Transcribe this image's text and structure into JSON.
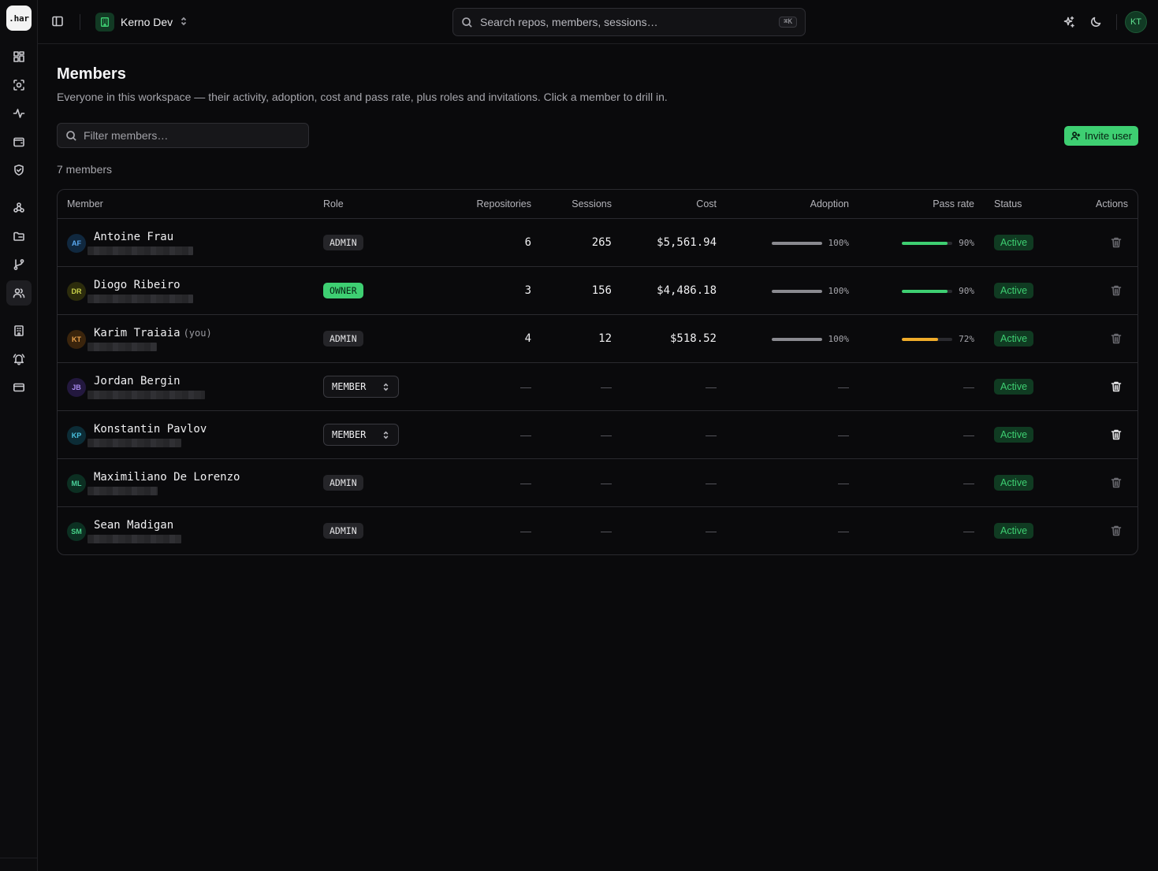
{
  "app": {
    "logo_text": ".har"
  },
  "sidebar": {
    "items": [
      {
        "name": "dashboard",
        "icon": "dashboard-icon",
        "active": false
      },
      {
        "name": "sessions",
        "icon": "scan-icon",
        "active": false
      },
      {
        "name": "activity",
        "icon": "activity-icon",
        "active": false
      },
      {
        "name": "wallet",
        "icon": "wallet-icon",
        "active": false
      },
      {
        "name": "security",
        "icon": "shield-icon",
        "active": false
      },
      {
        "name": "integrations",
        "icon": "network-icon",
        "active": false
      },
      {
        "name": "repositories",
        "icon": "folder-icon",
        "active": false
      },
      {
        "name": "branches",
        "icon": "git-branch-icon",
        "active": false
      },
      {
        "name": "members",
        "icon": "users-icon",
        "active": true
      },
      {
        "name": "organization",
        "icon": "building-icon",
        "active": false
      },
      {
        "name": "alerts",
        "icon": "bell-icon",
        "active": false
      },
      {
        "name": "billing",
        "icon": "credit-card-icon",
        "active": false
      }
    ]
  },
  "topbar": {
    "workspace": "Kerno Dev",
    "search_placeholder": "Search repos, members, sessions…",
    "search_shortcut": "⌘K",
    "user_initials": "KT"
  },
  "page": {
    "title": "Members",
    "subtitle": "Everyone in this workspace — their activity, adoption, cost and pass rate, plus roles and invitations. Click a member to drill in.",
    "filter_placeholder": "Filter members…",
    "invite_label": "Invite user",
    "member_count": "7 members"
  },
  "table": {
    "headers": {
      "member": "Member",
      "role": "Role",
      "repositories": "Repositories",
      "sessions": "Sessions",
      "cost": "Cost",
      "adoption": "Adoption",
      "pass_rate": "Pass rate",
      "status": "Status",
      "actions": "Actions"
    },
    "empty": "—",
    "rows": [
      {
        "initials": "AF",
        "name": "Antoine Frau",
        "you": "",
        "role": "ADMIN",
        "role_type": "badge",
        "repositories": "6",
        "sessions": "265",
        "cost": "$5,561.94",
        "adoption": 1.0,
        "adoption_label": "100%",
        "pass_rate": 0.9,
        "pass_label": "90%",
        "status": "Active",
        "avatar_bg": "#10283f",
        "avatar_fg": "#5aa9f0",
        "email_w": 134
      },
      {
        "initials": "DR",
        "name": "Diogo Ribeiro",
        "you": "",
        "role": "OWNER",
        "role_type": "owner",
        "repositories": "3",
        "sessions": "156",
        "cost": "$4,486.18",
        "adoption": 1.0,
        "adoption_label": "100%",
        "pass_rate": 0.9,
        "pass_label": "90%",
        "status": "Active",
        "avatar_bg": "#2c2c0c",
        "avatar_fg": "#c9d14a",
        "email_w": 134
      },
      {
        "initials": "KT",
        "name": "Karim Traiaia",
        "you": "(you)",
        "role": "ADMIN",
        "role_type": "badge",
        "repositories": "4",
        "sessions": "12",
        "cost": "$518.52",
        "adoption": 1.0,
        "adoption_label": "100%",
        "pass_rate": 0.72,
        "pass_label": "72%",
        "status": "Active",
        "avatar_bg": "#3a240c",
        "avatar_fg": "#e8a04a",
        "email_w": 88
      },
      {
        "initials": "JB",
        "name": "Jordan Bergin",
        "you": "",
        "role": "MEMBER",
        "role_type": "select",
        "status": "Active",
        "avatar_bg": "#23183e",
        "avatar_fg": "#a88af0",
        "email_w": 149
      },
      {
        "initials": "KP",
        "name": "Konstantin Pavlov",
        "you": "",
        "role": "MEMBER",
        "role_type": "select",
        "status": "Active",
        "avatar_bg": "#0c2c36",
        "avatar_fg": "#4ac2e0",
        "email_w": 119
      },
      {
        "initials": "ML",
        "name": "Maximiliano De Lorenzo",
        "you": "",
        "role": "ADMIN",
        "role_type": "badge",
        "status": "Active",
        "avatar_bg": "#0c2f22",
        "avatar_fg": "#4ad09a",
        "email_w": 89
      },
      {
        "initials": "SM",
        "name": "Sean Madigan",
        "you": "",
        "role": "ADMIN",
        "role_type": "badge",
        "status": "Active",
        "avatar_bg": "#0c3022",
        "avatar_fg": "#48d48a",
        "email_w": 119
      }
    ]
  },
  "colors": {
    "accent": "#3ecf72",
    "warning": "#f0ac2a",
    "neutral_bar": "#8a8a90"
  }
}
